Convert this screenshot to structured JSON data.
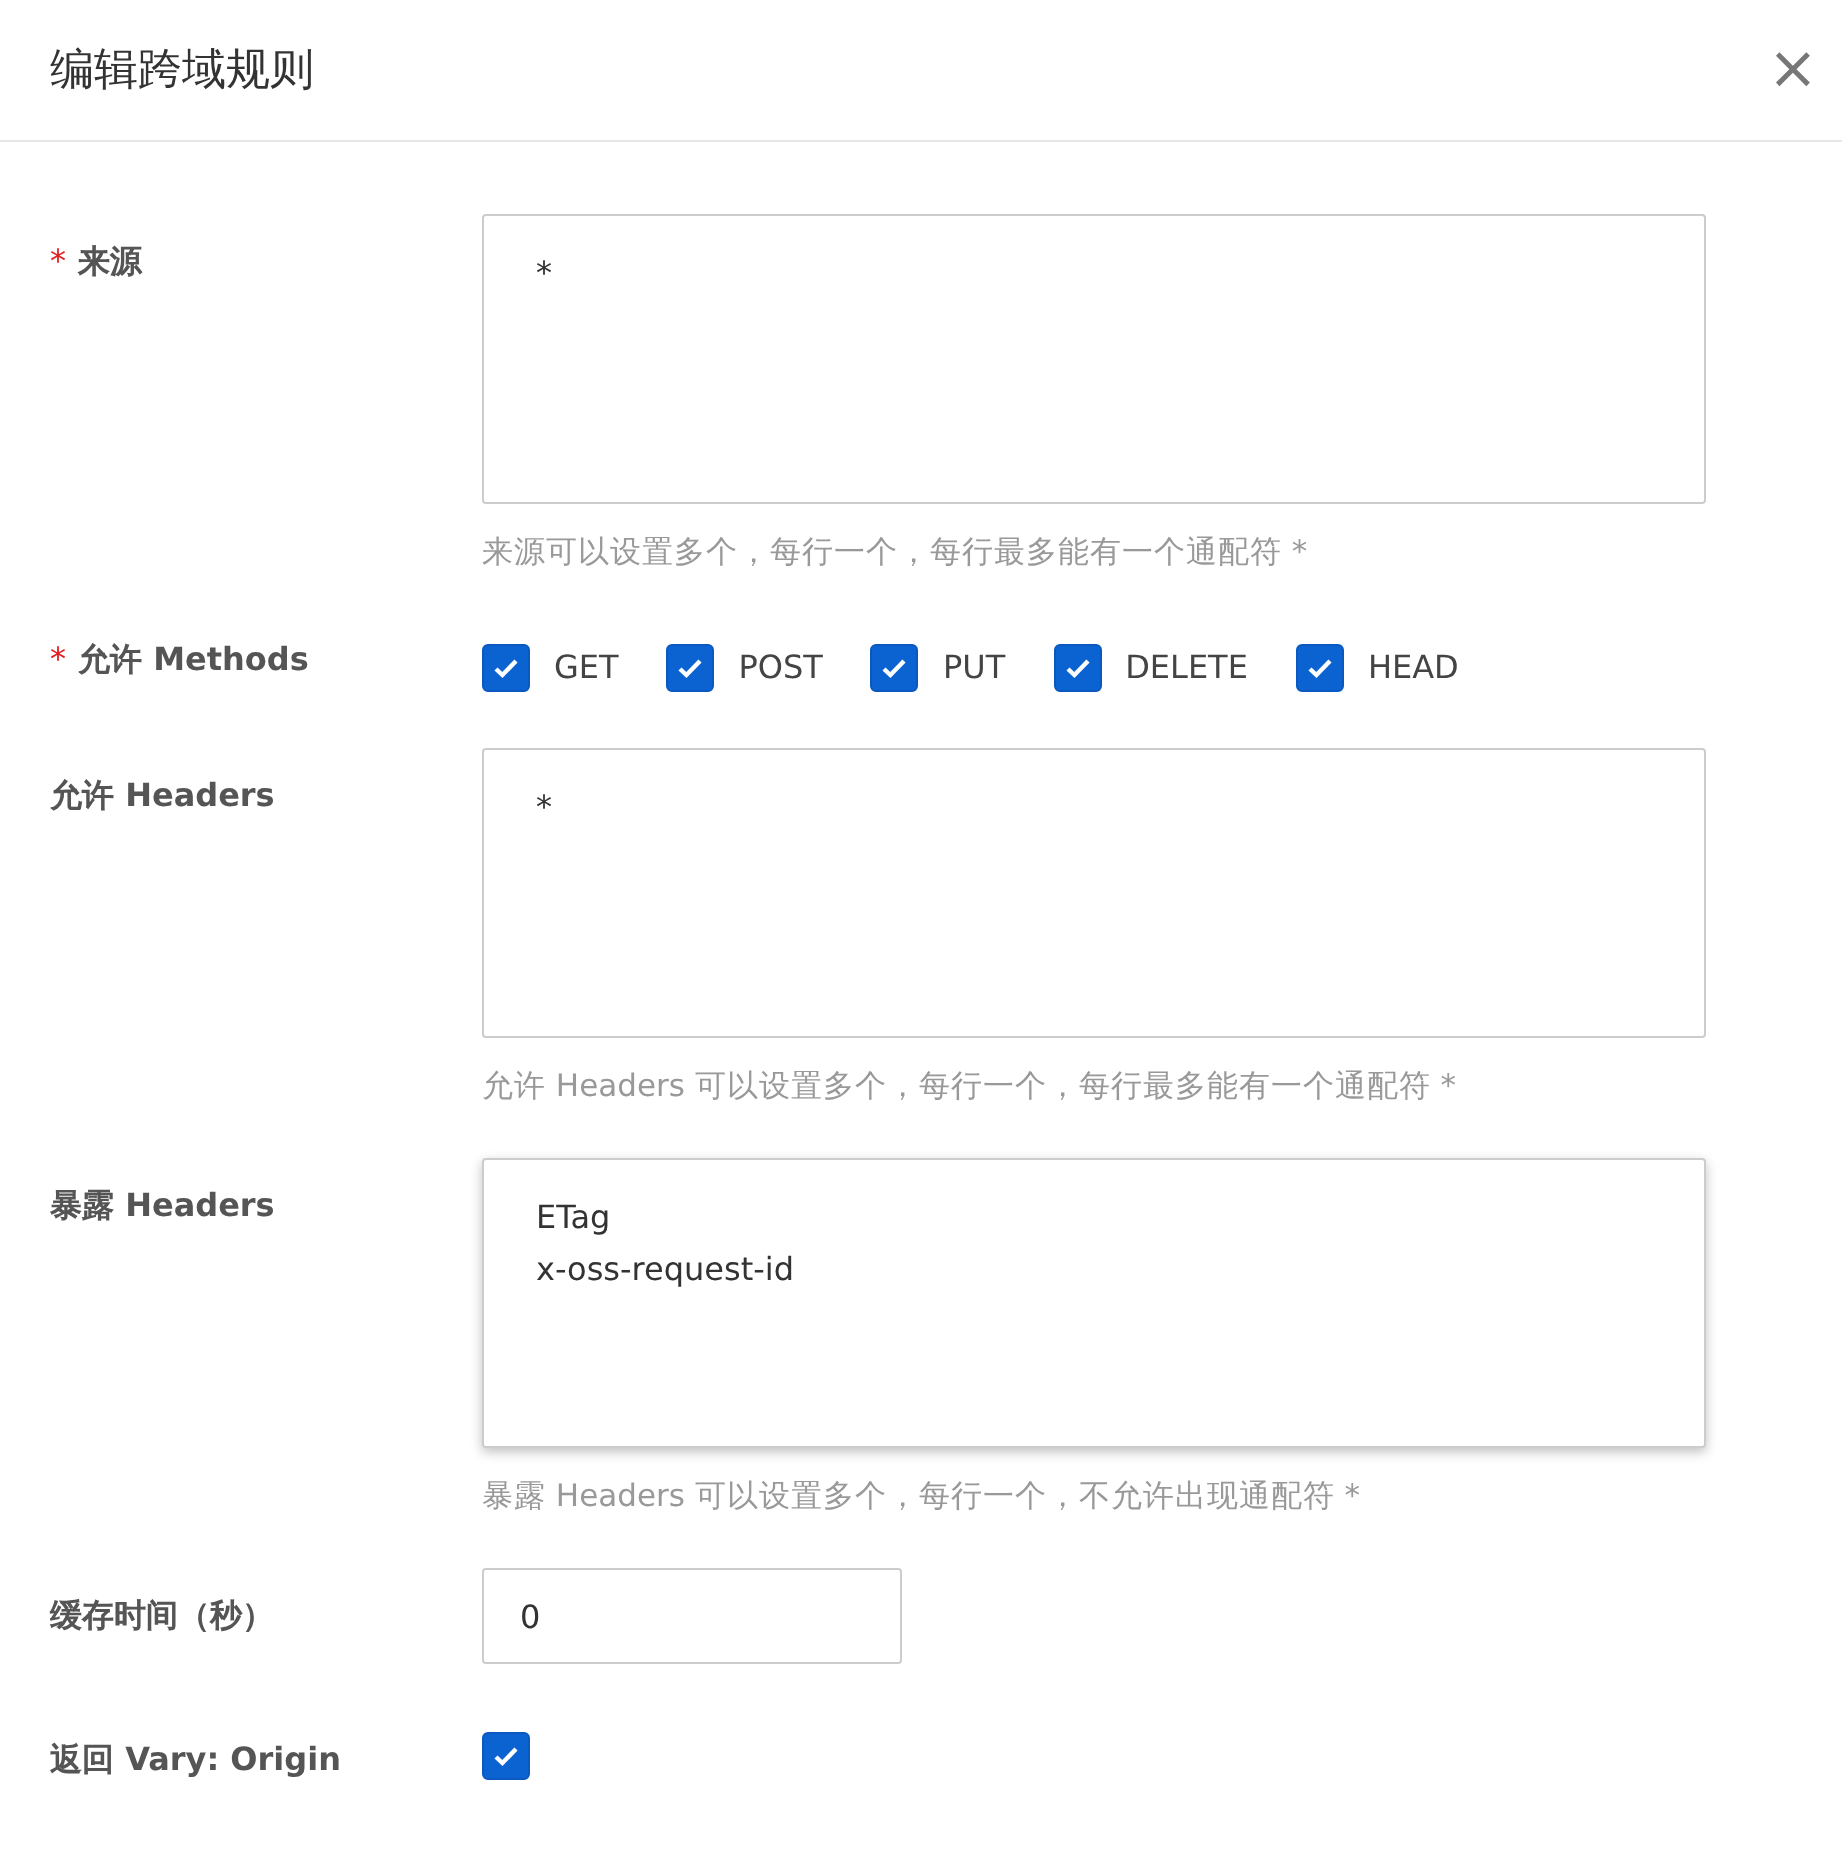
{
  "dialog": {
    "title": "编辑跨域规则",
    "close": "×"
  },
  "fields": [
    {
      "kind": "textarea",
      "label": "来源",
      "required_mark": "*",
      "value": "*",
      "focused": false,
      "hint": "来源可以设置多个，每行一个，每行最多能有一个通配符 *"
    },
    {
      "kind": "checkboxes",
      "label": "允许 Methods",
      "required_mark": "*",
      "options": [
        {
          "label": "GET",
          "checked": true
        },
        {
          "label": "POST",
          "checked": true
        },
        {
          "label": "PUT",
          "checked": true
        },
        {
          "label": "DELETE",
          "checked": true
        },
        {
          "label": "HEAD",
          "checked": true
        }
      ]
    },
    {
      "kind": "textarea",
      "label": "允许 Headers",
      "value": "*",
      "focused": false,
      "hint": "允许 Headers 可以设置多个，每行一个，每行最多能有一个通配符 *"
    },
    {
      "kind": "textarea",
      "label": "暴露 Headers",
      "value": "ETag\nx-oss-request-id",
      "focused": true,
      "hint": "暴露 Headers 可以设置多个，每行一个，不允许出现通配符 *"
    },
    {
      "kind": "number",
      "label": "缓存时间（秒）",
      "value": "0"
    },
    {
      "kind": "checkbox",
      "label": "返回 Vary: Origin",
      "checked": true
    }
  ]
}
